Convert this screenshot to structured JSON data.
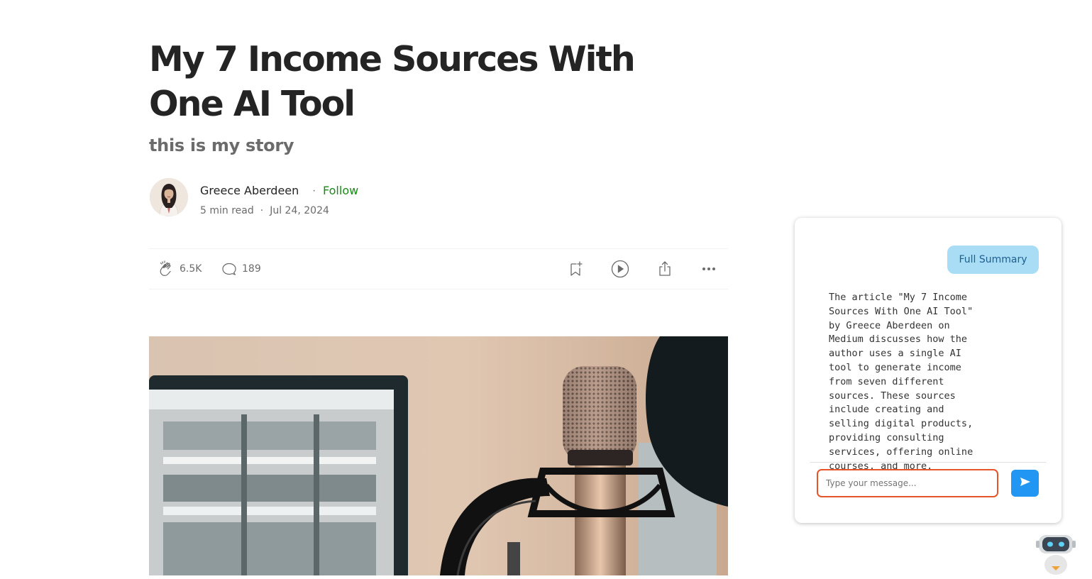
{
  "article": {
    "title": "My 7 Income Sources With One AI Tool",
    "subtitle": "this is my story",
    "author": {
      "name": "Greece Aberdeen",
      "separator": "·",
      "follow_label": "Follow"
    },
    "meta": {
      "read_time": "5 min read",
      "separator": "·",
      "date": "Jul 24, 2024"
    },
    "actions": {
      "claps": "6.5K",
      "responses": "189",
      "icons": [
        "clap-icon",
        "response-icon",
        "bookmark-add-icon",
        "play-icon",
        "share-icon",
        "more-icon"
      ]
    },
    "hero_image": "podcast-microphone-photo"
  },
  "chat": {
    "user_message": "Full Summary",
    "bot_message": "The article \"My 7 Income Sources With One AI Tool\" by Greece Aberdeen on Medium discusses how the author uses a single AI tool to generate income from seven different sources. These sources include creating and selling digital products, providing consulting services, offering online courses, and more.",
    "input": {
      "value": "",
      "placeholder": "Type your message..."
    },
    "send_icon": "send-icon",
    "colors": {
      "user_bubble": "#a8ddf5",
      "input_border": "#e8542a",
      "send_button": "#2196f3"
    }
  },
  "assistant_icon": "robot-icon",
  "colors": {
    "follow": "#1a8917",
    "text": "#242424",
    "muted": "#6b6b6b"
  }
}
